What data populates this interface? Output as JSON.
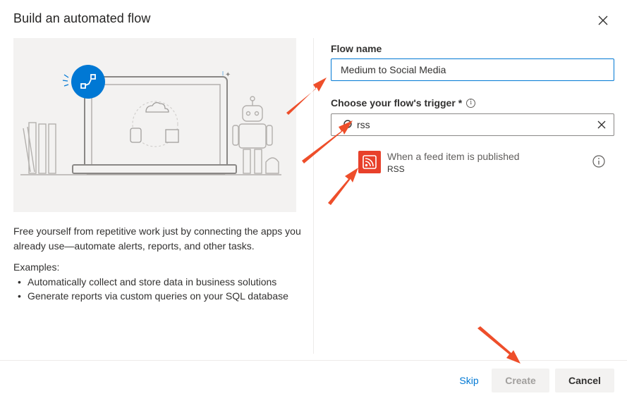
{
  "dialog": {
    "title": "Build an automated flow"
  },
  "left": {
    "description": "Free yourself from repetitive work just by connecting the apps you already use—automate alerts, reports, and other tasks.",
    "examples_title": "Examples:",
    "examples": [
      "Automatically collect and store data in business solutions",
      "Generate reports via custom queries on your SQL database"
    ]
  },
  "form": {
    "flow_name_label": "Flow name",
    "flow_name_value": "Medium to Social Media",
    "trigger_label": "Choose your flow's trigger",
    "required_mark": "*",
    "info_glyph": "i",
    "search_value": "rss"
  },
  "trigger_results": [
    {
      "name": "When a feed item is published",
      "connector": "RSS",
      "icon": "rss-icon"
    }
  ],
  "footer": {
    "skip_label": "Skip",
    "create_label": "Create",
    "cancel_label": "Cancel"
  },
  "colors": {
    "accent": "#0078d4",
    "rss_tile": "#e8402a",
    "annotation_arrow": "#ee4e2a",
    "illustration_bg": "#f3f2f1"
  }
}
